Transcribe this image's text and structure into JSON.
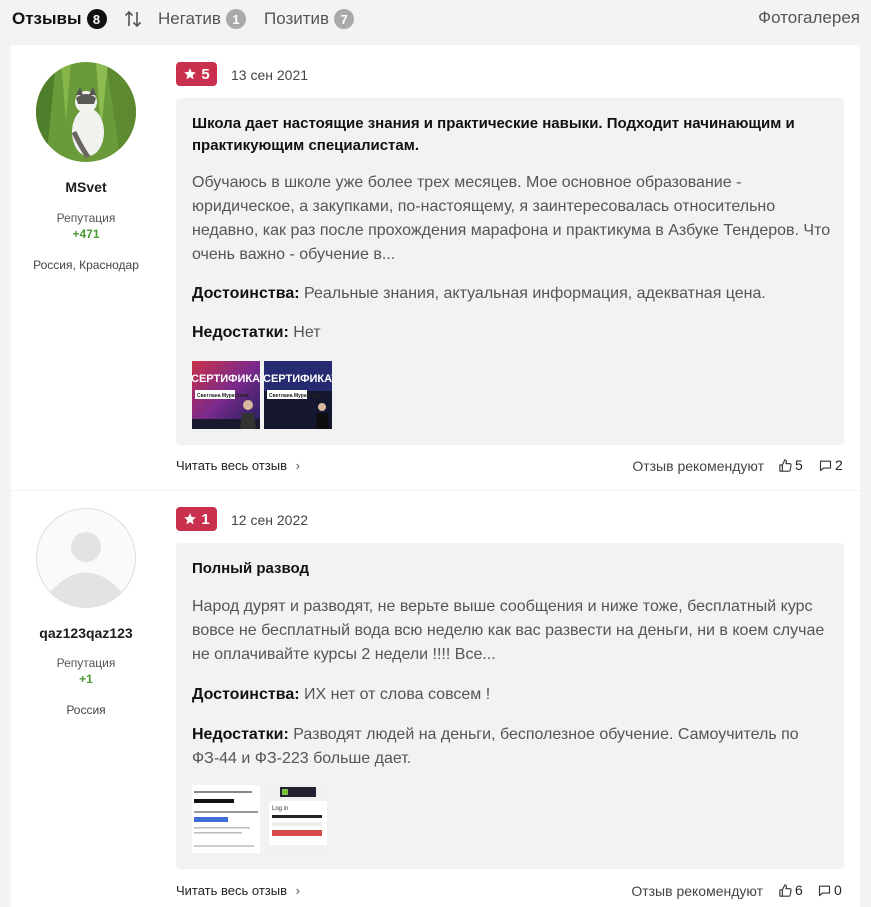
{
  "tabs": {
    "reviews_label": "Отзывы",
    "reviews_count": "8",
    "negative_label": "Негатив",
    "negative_count": "1",
    "positive_label": "Позитив",
    "positive_count": "7",
    "gallery_label": "Фотогалерея"
  },
  "reviews": [
    {
      "username": "MSvet",
      "reputation_label": "Репутация",
      "reputation_value": "+471",
      "location": "Россия, Краснодар",
      "rating": "5",
      "date": "13 сен 2021",
      "title": "Школа дает настоящие знания и практические навыки. Подходит начинающим и практикующим специалистам.",
      "text": "Обучаюсь в школе уже более трех месяцев. Мое основное образование - юридическое, а закупками, по-настоящему, я заинтересовалась относительно недавно, как раз после прохождения марафона и практикума в Азбуке Тендеров. Что очень важно - обучение в...",
      "pros_label": "Достоинства:",
      "pros": "Реальные знания, актуальная информация, адекватная цена.",
      "cons_label": "Недостатки:",
      "cons": "Нет",
      "thumb1_title": "СЕРТИФИКАТ",
      "thumb1_name": "Светлана Муратхина",
      "thumb2_title": "СЕРТИФИКАТ",
      "thumb2_name": "Светлана Муратхина",
      "read_more": "Читать весь отзыв",
      "recommend_label": "Отзыв рекомендуют",
      "likes": "5",
      "comments": "2"
    },
    {
      "username": "qaz123qaz123",
      "reputation_label": "Репутация",
      "reputation_value": "+1",
      "location": "Россия",
      "rating": "1",
      "date": "12 сен 2022",
      "title": "Полный развод",
      "text": "Народ дурят и разводят, не верьте выше сообщения и ниже тоже, бесплатный курс вовсе не бесплатный вода всю неделю как вас развести на деньги, ни в коем случае не оплачивайте курсы 2 недели !!!! Все...",
      "pros_label": "Достоинства:",
      "pros": "ИХ нет от слова совсем !",
      "cons_label": "Недостатки:",
      "cons": "Разводят людей на деньги, бесполезное обучение. Самоучитель по ФЗ-44 и ФЗ-223 больше дает.",
      "thumb2_login": "Log in",
      "read_more": "Читать весь отзыв",
      "recommend_label": "Отзыв рекомендуют",
      "likes": "6",
      "comments": "0"
    }
  ]
}
